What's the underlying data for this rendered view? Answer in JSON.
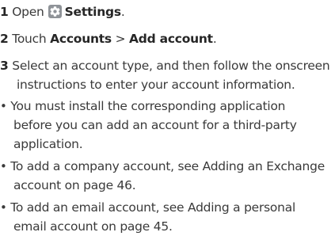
{
  "steps": [
    {
      "number": "1",
      "text_before": "Open",
      "icon": "gear-icon",
      "bold_text": "Settings",
      "text_after": "."
    },
    {
      "number": "2",
      "text_before": "Touch",
      "bold_1": "Accounts",
      "separator": ">",
      "bold_2": "Add account",
      "text_after": "."
    },
    {
      "number": "3",
      "line1": "Select an account type, and then follow the onscreen",
      "line2": "instructions to enter your account information."
    }
  ],
  "notes": [
    {
      "bullet": "•",
      "lines": [
        "You must install the corresponding application",
        "before you can add an account for a third-party",
        "application."
      ]
    },
    {
      "bullet": "•",
      "lines": [
        "To add a company account, see Adding an Exchange",
        "account on page 46."
      ]
    },
    {
      "bullet": "•",
      "lines": [
        "To add an email account, see Adding a personal",
        "email account on page 45."
      ]
    }
  ],
  "colors": {
    "text": "#3a3a3a",
    "icon_bg": "#8f9398"
  }
}
